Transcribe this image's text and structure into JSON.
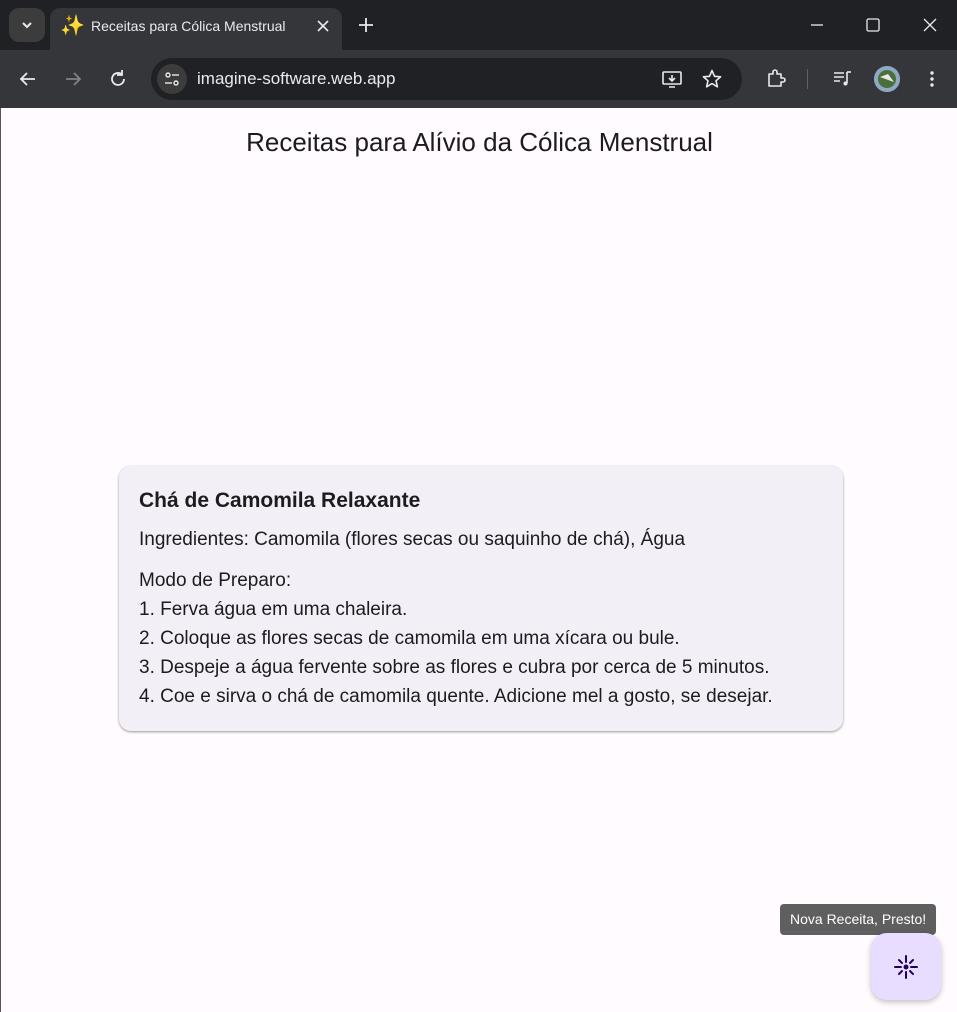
{
  "browser": {
    "tab": {
      "title": "Receitas para Cólica Menstrual",
      "icon": "sparkles-icon"
    },
    "url": "imagine-software.web.app"
  },
  "page": {
    "title": "Receitas para Alívio da Cólica Menstrual"
  },
  "recipe": {
    "title": "Chá de Camomila Relaxante",
    "ingredients": "Ingredientes: Camomila (flores secas ou saquinho de chá), Água",
    "preparation_header": "Modo de Preparo:",
    "steps": [
      "1. Ferva água em uma chaleira.",
      "2. Coloque as flores secas de camomila em uma xícara ou bule.",
      "3. Despeje a água fervente sobre as flores e cubra por cerca de 5 minutos.",
      "4. Coe e sirva o chá de camomila quente. Adicione mel a gosto, se desejar."
    ]
  },
  "fab": {
    "tooltip": "Nova Receita, Presto!",
    "icon": "sparkle-burst-icon"
  },
  "colors": {
    "page_bg": "#fffbfe",
    "card_bg": "#f3eff6",
    "fab_bg": "#e9ddff",
    "fab_icon": "#21005d"
  }
}
